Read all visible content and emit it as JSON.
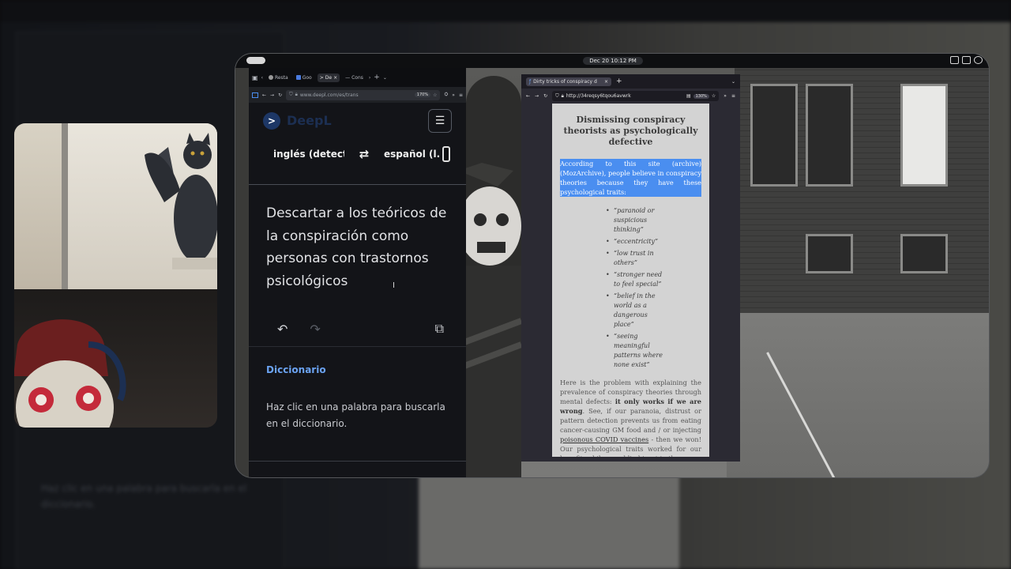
{
  "system": {
    "clock": "Dec 20  10:12 PM"
  },
  "deepl_browser": {
    "tabs": [
      {
        "label": "Resta",
        "icon": "globe-icon"
      },
      {
        "label": "Goo",
        "icon": "google-icon"
      },
      {
        "label": "De",
        "icon": "deepl-icon",
        "active": true
      },
      {
        "label": "Cons",
        "icon": "dash-icon"
      }
    ],
    "url": "www.deepl.com/es/trans",
    "zoom": "170%",
    "app": {
      "logo": "DeepL",
      "source_lang": "inglés (detectac",
      "target_lang": "español (l...",
      "translation": "Descartar a los teóricos de la conspiración como personas con trastornos psicológicos",
      "dictionary_heading": "Diccionario",
      "dictionary_hint": "Haz clic en una palabra para buscarla en el diccionario."
    }
  },
  "archive_browser": {
    "tab_title": "Dirty tricks of conspiracy d",
    "url": "http://34reqsy6tqou6avwrk",
    "zoom": "130%",
    "article": {
      "heading": "Dismissing conspiracy theorists as psychologically defective",
      "selected_paragraph": "According to this site (archive) (MozArchive), people believe in conspiracy theories because they have these psychological traits:",
      "traits": [
        "“paranoid or suspicious thinking”",
        "“eccentricity”",
        "“low trust in others”",
        "“stronger need to feel special”",
        "“belief in the world as a dangerous place”",
        "“seeing meaningful patterns where none exist”"
      ],
      "body_intro": "Here is the problem with explaining the prevalence of conspiracy theories through mental defects: ",
      "body_bold1": "it only works if we are wrong",
      "body_mid": ". See, if our paranoia, distrust or pattern detection prevents us from eating cancer-causing GM food and / or injecting ",
      "body_link": "poisonous COVID vaccines",
      "body_end": " - then we won! Our psychological traits worked for our benefit, while your blind trust in the"
    }
  },
  "background": {
    "blurred_text": "Haz clic en una palabra para buscarla en el diccionario."
  }
}
